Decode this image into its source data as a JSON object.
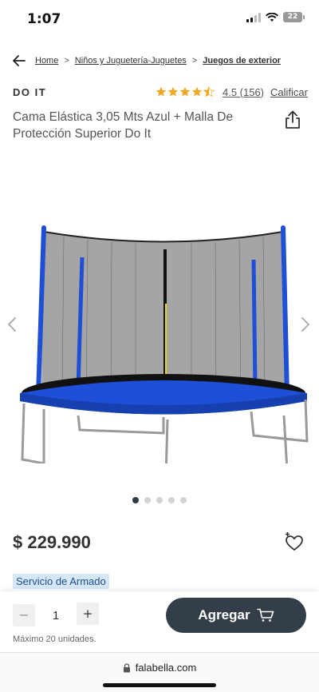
{
  "status_bar": {
    "time": "1:07",
    "battery": "22"
  },
  "breadcrumb": {
    "items": [
      "Home",
      "Niños y Juguetería-Juguetes",
      "Juegos de exterior"
    ],
    "separator": ">"
  },
  "product": {
    "brand": "DO IT",
    "rating_value": 4.5,
    "rating_text": "4.5 (156)",
    "rate_link": "Calificar",
    "title": "Cama Elástica 3,05 Mts Azul + Malla De Protección Superior Do It",
    "price": "$ 229.990",
    "service_tag": "Servicio de Armado"
  },
  "carousel": {
    "image_count": 5,
    "active_index": 0
  },
  "purchase": {
    "quantity_minus": "−",
    "quantity": "1",
    "quantity_plus": "+",
    "max_units": "Máximo 20 unidades.",
    "add_button": "Agregar"
  },
  "browser": {
    "url": "falabella.com"
  },
  "colors": {
    "star": "#f5a623",
    "add_button_bg": "#343e48",
    "service_tag_bg": "#d6e7f8",
    "trampoline_blue": "#1e4fd6"
  },
  "icons": [
    "signal-icon",
    "wifi-icon",
    "battery-icon",
    "back-arrow-icon",
    "star-icon",
    "share-icon",
    "chevron-left-icon",
    "chevron-right-icon",
    "heart-plus-icon",
    "cart-icon",
    "lock-icon"
  ]
}
